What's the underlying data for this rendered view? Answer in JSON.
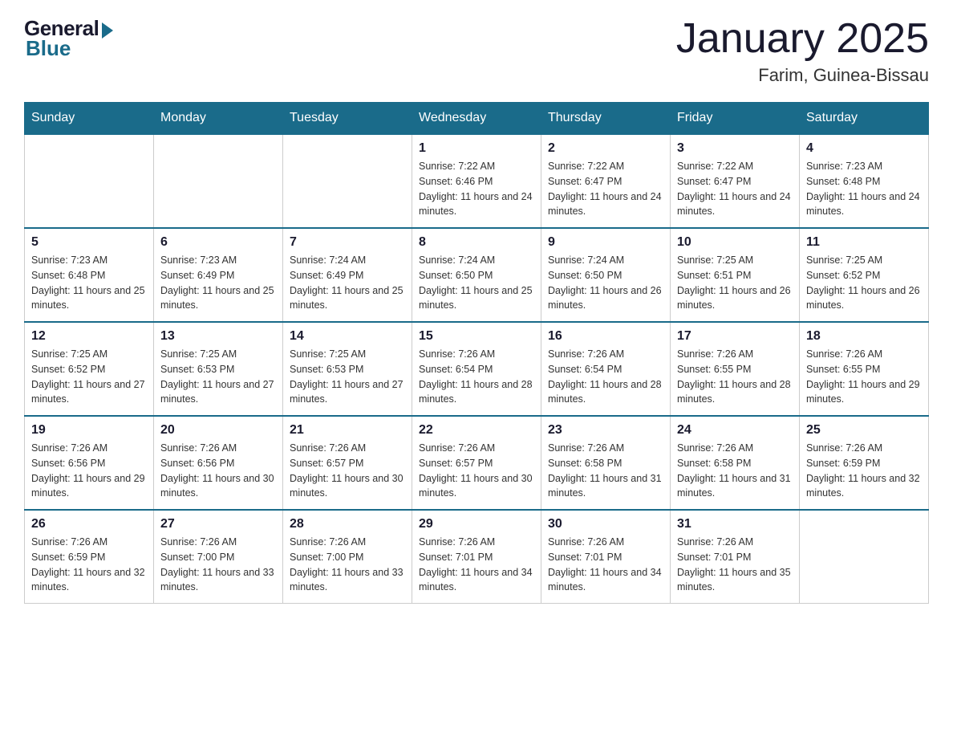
{
  "logo": {
    "general": "General",
    "blue": "Blue"
  },
  "title": "January 2025",
  "location": "Farim, Guinea-Bissau",
  "weekdays": [
    "Sunday",
    "Monday",
    "Tuesday",
    "Wednesday",
    "Thursday",
    "Friday",
    "Saturday"
  ],
  "weeks": [
    [
      {
        "day": "",
        "info": ""
      },
      {
        "day": "",
        "info": ""
      },
      {
        "day": "",
        "info": ""
      },
      {
        "day": "1",
        "info": "Sunrise: 7:22 AM\nSunset: 6:46 PM\nDaylight: 11 hours and 24 minutes."
      },
      {
        "day": "2",
        "info": "Sunrise: 7:22 AM\nSunset: 6:47 PM\nDaylight: 11 hours and 24 minutes."
      },
      {
        "day": "3",
        "info": "Sunrise: 7:22 AM\nSunset: 6:47 PM\nDaylight: 11 hours and 24 minutes."
      },
      {
        "day": "4",
        "info": "Sunrise: 7:23 AM\nSunset: 6:48 PM\nDaylight: 11 hours and 24 minutes."
      }
    ],
    [
      {
        "day": "5",
        "info": "Sunrise: 7:23 AM\nSunset: 6:48 PM\nDaylight: 11 hours and 25 minutes."
      },
      {
        "day": "6",
        "info": "Sunrise: 7:23 AM\nSunset: 6:49 PM\nDaylight: 11 hours and 25 minutes."
      },
      {
        "day": "7",
        "info": "Sunrise: 7:24 AM\nSunset: 6:49 PM\nDaylight: 11 hours and 25 minutes."
      },
      {
        "day": "8",
        "info": "Sunrise: 7:24 AM\nSunset: 6:50 PM\nDaylight: 11 hours and 25 minutes."
      },
      {
        "day": "9",
        "info": "Sunrise: 7:24 AM\nSunset: 6:50 PM\nDaylight: 11 hours and 26 minutes."
      },
      {
        "day": "10",
        "info": "Sunrise: 7:25 AM\nSunset: 6:51 PM\nDaylight: 11 hours and 26 minutes."
      },
      {
        "day": "11",
        "info": "Sunrise: 7:25 AM\nSunset: 6:52 PM\nDaylight: 11 hours and 26 minutes."
      }
    ],
    [
      {
        "day": "12",
        "info": "Sunrise: 7:25 AM\nSunset: 6:52 PM\nDaylight: 11 hours and 27 minutes."
      },
      {
        "day": "13",
        "info": "Sunrise: 7:25 AM\nSunset: 6:53 PM\nDaylight: 11 hours and 27 minutes."
      },
      {
        "day": "14",
        "info": "Sunrise: 7:25 AM\nSunset: 6:53 PM\nDaylight: 11 hours and 27 minutes."
      },
      {
        "day": "15",
        "info": "Sunrise: 7:26 AM\nSunset: 6:54 PM\nDaylight: 11 hours and 28 minutes."
      },
      {
        "day": "16",
        "info": "Sunrise: 7:26 AM\nSunset: 6:54 PM\nDaylight: 11 hours and 28 minutes."
      },
      {
        "day": "17",
        "info": "Sunrise: 7:26 AM\nSunset: 6:55 PM\nDaylight: 11 hours and 28 minutes."
      },
      {
        "day": "18",
        "info": "Sunrise: 7:26 AM\nSunset: 6:55 PM\nDaylight: 11 hours and 29 minutes."
      }
    ],
    [
      {
        "day": "19",
        "info": "Sunrise: 7:26 AM\nSunset: 6:56 PM\nDaylight: 11 hours and 29 minutes."
      },
      {
        "day": "20",
        "info": "Sunrise: 7:26 AM\nSunset: 6:56 PM\nDaylight: 11 hours and 30 minutes."
      },
      {
        "day": "21",
        "info": "Sunrise: 7:26 AM\nSunset: 6:57 PM\nDaylight: 11 hours and 30 minutes."
      },
      {
        "day": "22",
        "info": "Sunrise: 7:26 AM\nSunset: 6:57 PM\nDaylight: 11 hours and 30 minutes."
      },
      {
        "day": "23",
        "info": "Sunrise: 7:26 AM\nSunset: 6:58 PM\nDaylight: 11 hours and 31 minutes."
      },
      {
        "day": "24",
        "info": "Sunrise: 7:26 AM\nSunset: 6:58 PM\nDaylight: 11 hours and 31 minutes."
      },
      {
        "day": "25",
        "info": "Sunrise: 7:26 AM\nSunset: 6:59 PM\nDaylight: 11 hours and 32 minutes."
      }
    ],
    [
      {
        "day": "26",
        "info": "Sunrise: 7:26 AM\nSunset: 6:59 PM\nDaylight: 11 hours and 32 minutes."
      },
      {
        "day": "27",
        "info": "Sunrise: 7:26 AM\nSunset: 7:00 PM\nDaylight: 11 hours and 33 minutes."
      },
      {
        "day": "28",
        "info": "Sunrise: 7:26 AM\nSunset: 7:00 PM\nDaylight: 11 hours and 33 minutes."
      },
      {
        "day": "29",
        "info": "Sunrise: 7:26 AM\nSunset: 7:01 PM\nDaylight: 11 hours and 34 minutes."
      },
      {
        "day": "30",
        "info": "Sunrise: 7:26 AM\nSunset: 7:01 PM\nDaylight: 11 hours and 34 minutes."
      },
      {
        "day": "31",
        "info": "Sunrise: 7:26 AM\nSunset: 7:01 PM\nDaylight: 11 hours and 35 minutes."
      },
      {
        "day": "",
        "info": ""
      }
    ]
  ]
}
